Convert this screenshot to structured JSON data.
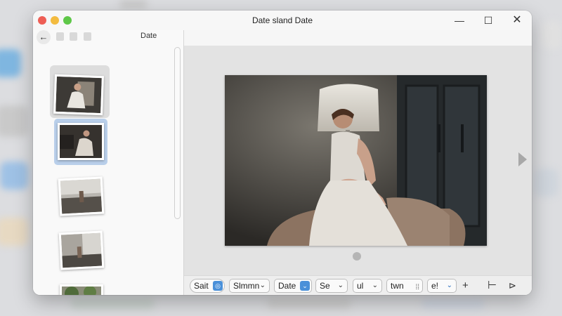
{
  "window": {
    "title": "Date sland Date",
    "controls": {
      "minimize_icon": "—",
      "maximize_icon": "☐",
      "close_icon": "✕"
    }
  },
  "sidebar": {
    "back_icon": "←",
    "title": "Date",
    "thumbnails": [
      {
        "name": "thumbnail-1",
        "selected": false
      },
      {
        "name": "thumbnail-2",
        "selected": true
      },
      {
        "name": "thumbnail-3",
        "selected": false
      },
      {
        "name": "thumbnail-4",
        "selected": false
      },
      {
        "name": "thumbnail-5",
        "selected": false
      }
    ]
  },
  "viewer": {
    "next_icon": "arrow-right-icon"
  },
  "bottom_bar": {
    "sort": {
      "label": "Sait",
      "icon": "◎"
    },
    "c2": {
      "label": "Slmmn",
      "chevron": "⌄"
    },
    "date": {
      "label": "Date",
      "chevron": "⌄"
    },
    "c4": {
      "label": "Se",
      "chevron": "⌄"
    },
    "c5": {
      "label": "ul",
      "chevron": "⌄"
    },
    "c6": {
      "label": "twn",
      "grid_icon": "⁞⁞"
    },
    "c7": {
      "label": "e!",
      "chevron": "⌄"
    },
    "tools": {
      "add": "+",
      "split": "⊢",
      "share": "⊳"
    }
  },
  "colors": {
    "accent": "#4a90d9",
    "selection": "#b9cfea"
  }
}
